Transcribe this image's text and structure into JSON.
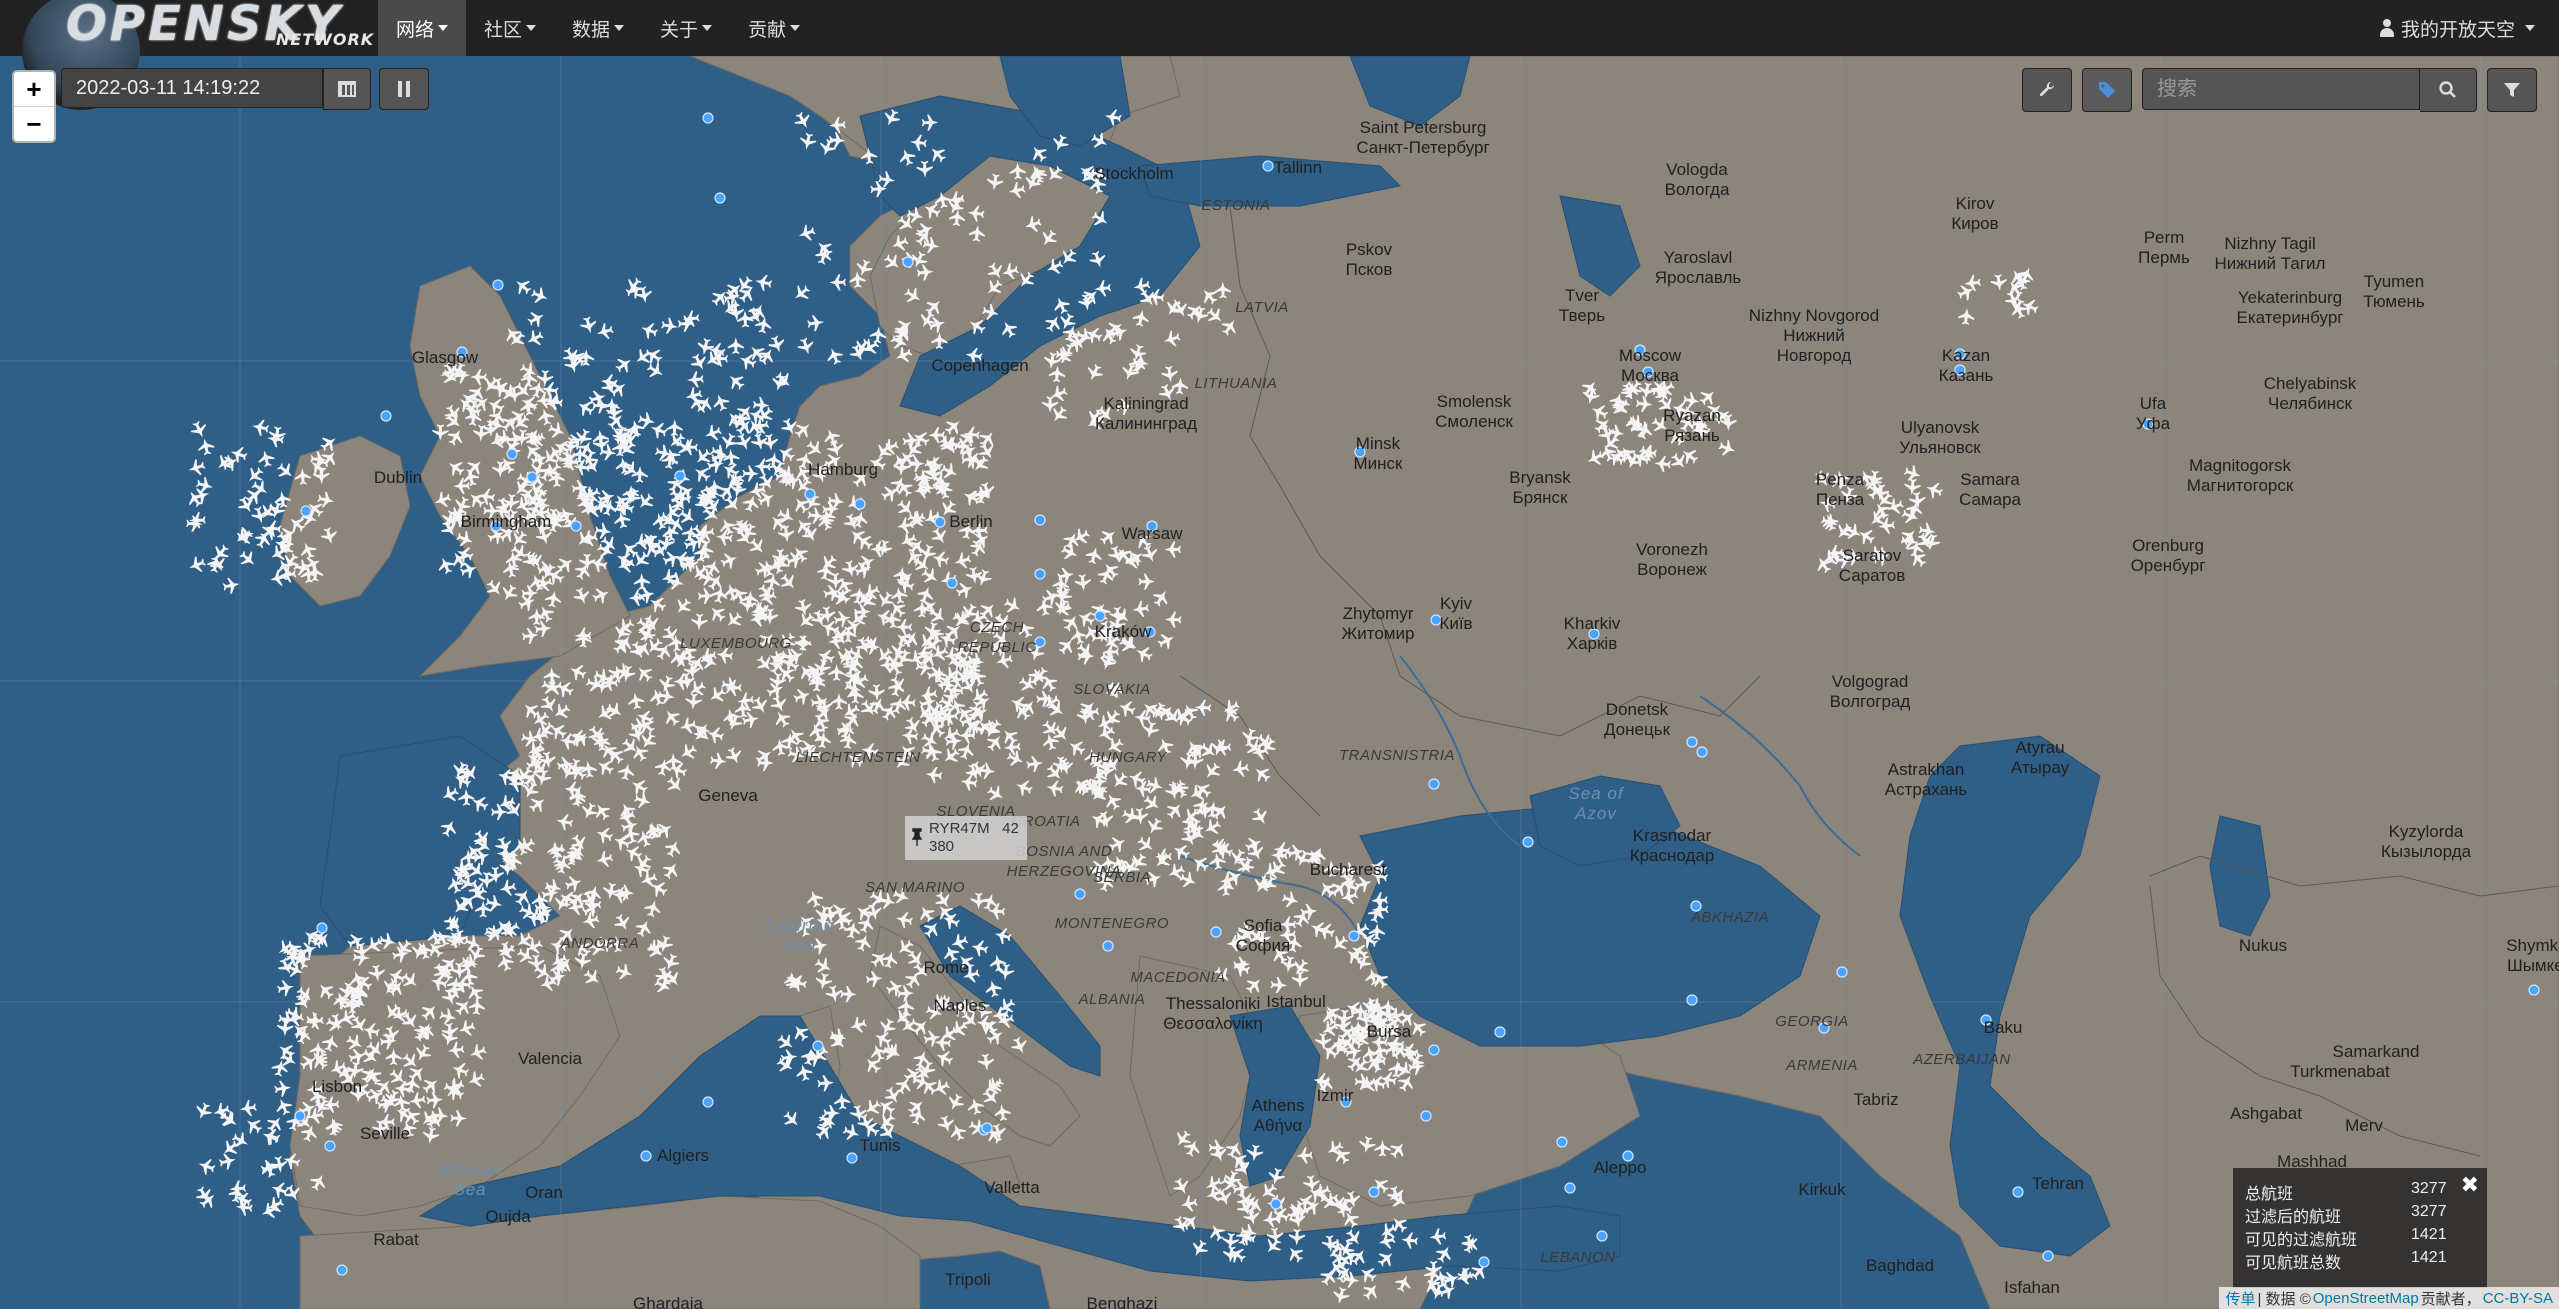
{
  "navbar": {
    "brand": {
      "logo_text": "OPENSKY",
      "logo_sub": "NETWORK"
    },
    "menu": [
      {
        "label": "网络",
        "active": true
      },
      {
        "label": "社区",
        "active": false
      },
      {
        "label": "数据",
        "active": false
      },
      {
        "label": "关于",
        "active": false
      },
      {
        "label": "贡献",
        "active": false
      }
    ],
    "user_label": "我的开放天空"
  },
  "controls": {
    "zoom_in": "+",
    "zoom_out": "−",
    "datetime": "2022-03-11 14:19:22",
    "search_placeholder": "搜索"
  },
  "aircraft_popup": {
    "callsign": "RYR47M",
    "value_a": "42",
    "value_b": "380"
  },
  "stats": {
    "rows": [
      {
        "label": "总航班",
        "value": "3277"
      },
      {
        "label": "过滤后的航班",
        "value": "3277"
      },
      {
        "label": "可见的过滤航班",
        "value": "1421"
      },
      {
        "label": "可见航班总数",
        "value": "1421"
      }
    ],
    "close": "✖"
  },
  "attribution": {
    "leaflet": "传单",
    "data_prefix": "| 数据 ©",
    "osm": "OpenStreetMap",
    "contrib": "贡献者，",
    "license": "CC-BY-SA"
  },
  "map_labels": {
    "cities": [
      "Saint Petersburg\nСанкт-Петербург",
      "Stockholm",
      "Tallinn",
      "Vologda\nВологда",
      "Kirov\nКиров",
      "Perm\nПермь",
      "Nizhny Tagil\nНижний Тагил",
      "Tyumen\nТюмень",
      "Pskov\nПсков",
      "Yaroslavl\nЯрославль",
      "Tver\nТверь",
      "Nizhny Novgorod\nНижний\nНовгород",
      "Yekaterinburg\nЕкатеринбург",
      "Glasgow",
      "Copenhagen",
      "Kaliningrad\nКалининград",
      "Smolensk\nСмоленск",
      "Moscow\nМосква",
      "Kazan\nКазань",
      "Chelyabinsk\nЧелябинск",
      "Ufa\nУфа",
      "Ryazan\nРязань",
      "Ulyanovsk\nУльяновск",
      "Dublin",
      "Minsk\nМинск",
      "Bryansk\nБрянск",
      "Samara\nСамара",
      "Penza\nПенза",
      "Magnitogorsk\nМагнитогорск",
      "Hamburg",
      "Berlin",
      "Birmingham",
      "Warsaw",
      "Voronezh\nВоронеж",
      "Saratov\nСаратов",
      "Orenburg\nОренбург",
      "Zhytomyr\nЖитомир",
      "Kyiv\nКиїв",
      "Kraków",
      "Kharkiv\nХарків",
      "Volgograd\nВолгоград",
      "Donetsk\nДонецьк",
      "Atyrau\nАтырау",
      "Astrakhan\nАстрахань",
      "Krasnodar\nКраснодар",
      "Kyzylorda\nКызылорда",
      "Bucharest",
      "Nukus",
      "Geneva",
      "Sofia\nСофия",
      "Thessaloniki\nΘεσσαλονίκη",
      "Rome",
      "Naples",
      "Baku",
      "Istanbul",
      "Bursa",
      "Izmir",
      "Athens\nΑθήνα",
      "Aleppo",
      "Tabriz",
      "Turkmenabat",
      "Samarkand",
      "Ashgabat",
      "Merv",
      "Mashhad",
      "Shymkent\nШымкент",
      "Valencia",
      "Lisbon",
      "Seville",
      "Algiers",
      "Tunis",
      "Valletta",
      "Oran",
      "Oujda",
      "Rabat",
      "Tripoli",
      "Ghardaia",
      "Benghazi",
      "Kirkuk",
      "Tehran",
      "Baghdad",
      "Isfahan"
    ],
    "countries": [
      "ESTONIA",
      "LATVIA",
      "LITHUANIA",
      "CZECH\nREPUBLIC",
      "LUXEMBOURG",
      "SLOVAKIA",
      "LIECHTENSTEIN",
      "HUNGARY",
      "TRANSNISTRIA",
      "SLOVENIA",
      "CROATIA",
      "BOSNIA AND\nHERZEGOVINA",
      "SAN MARINO",
      "SERBIA",
      "MONTENEGRO",
      "ALBANIA",
      "MACEDONIA",
      "ANDORRA",
      "ABKHAZIA",
      "GEORGIA",
      "ARMENIA",
      "AZERBAIJAN",
      "LEBANON"
    ],
    "seas": [
      "Sea of\nAzov",
      "Alboran\nSea",
      "Ligurian\nSea"
    ]
  }
}
